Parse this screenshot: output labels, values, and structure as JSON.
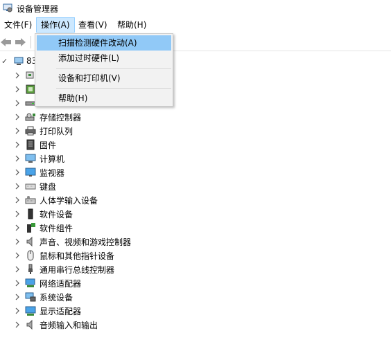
{
  "window": {
    "title": "设备管理器"
  },
  "menubar": {
    "items": [
      {
        "label": "文件(F)"
      },
      {
        "label": "操作(A)"
      },
      {
        "label": "查看(V)"
      },
      {
        "label": "帮助(H)"
      }
    ]
  },
  "action_menu": {
    "items": [
      {
        "label": "扫描检测硬件改动(A)"
      },
      {
        "label": "添加过时硬件(L)"
      },
      {
        "label": "设备和打印机(V)"
      },
      {
        "label": "帮助(H)"
      }
    ]
  },
  "tree": {
    "root_label": "83",
    "categories": [
      {
        "label": "",
        "icon": "audio-input-icon"
      },
      {
        "label": "",
        "icon": "processor-icon"
      },
      {
        "label": "",
        "icon": "disk-drive-icon"
      },
      {
        "label": "存储控制器",
        "icon": "storage-controller-icon"
      },
      {
        "label": "打印队列",
        "icon": "printer-icon"
      },
      {
        "label": "固件",
        "icon": "firmware-icon"
      },
      {
        "label": "计算机",
        "icon": "computer-icon"
      },
      {
        "label": "监视器",
        "icon": "monitor-icon"
      },
      {
        "label": "键盘",
        "icon": "keyboard-icon"
      },
      {
        "label": "人体学输入设备",
        "icon": "hid-icon"
      },
      {
        "label": "软件设备",
        "icon": "software-device-icon"
      },
      {
        "label": "软件组件",
        "icon": "software-component-icon"
      },
      {
        "label": "声音、视频和游戏控制器",
        "icon": "speaker-icon"
      },
      {
        "label": "鼠标和其他指针设备",
        "icon": "mouse-icon"
      },
      {
        "label": "通用串行总线控制器",
        "icon": "usb-icon"
      },
      {
        "label": "网络适配器",
        "icon": "network-adapter-icon"
      },
      {
        "label": "系统设备",
        "icon": "system-device-icon"
      },
      {
        "label": "显示适配器",
        "icon": "display-adapter-icon"
      },
      {
        "label": "音频输入和输出",
        "icon": "audio-io-icon"
      }
    ]
  },
  "colors": {
    "menu_highlight": "#91c9f7",
    "menubar_active_bg": "#cce8ff",
    "menubar_active_border": "#99d1ff"
  }
}
